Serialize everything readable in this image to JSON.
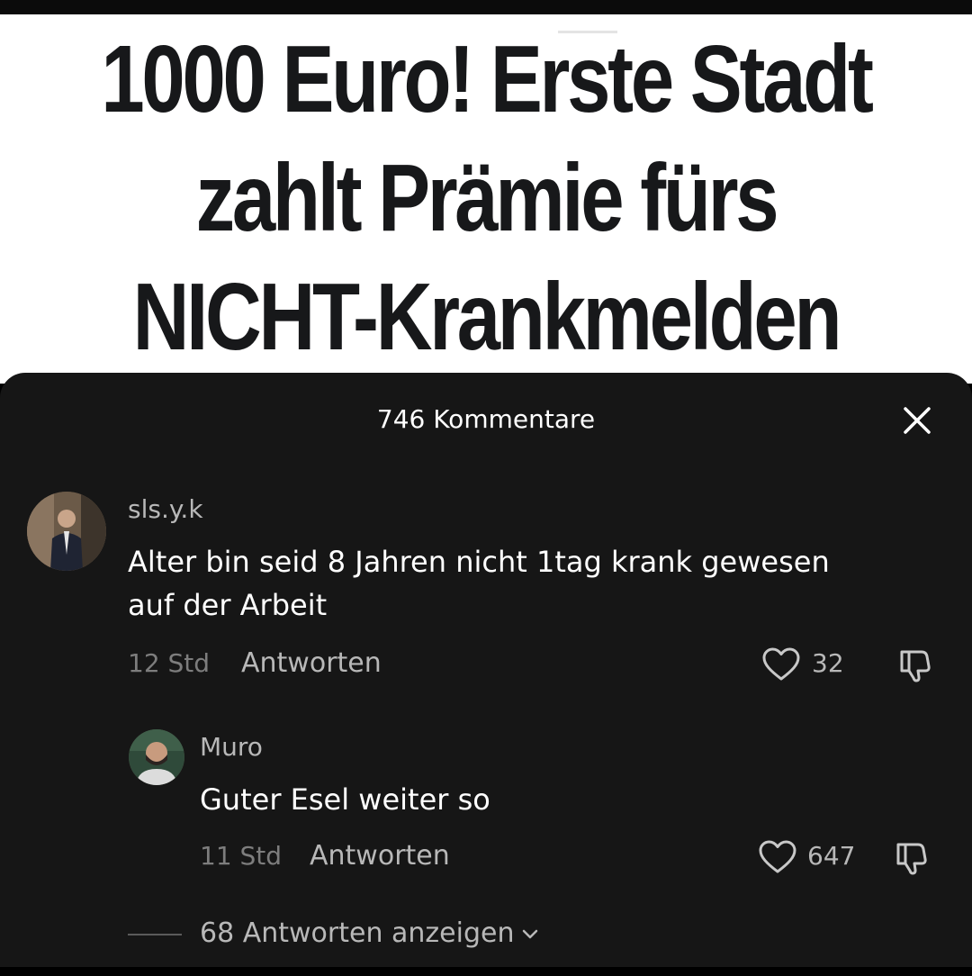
{
  "headline": {
    "line1": "1000 Euro! Erste Stadt",
    "line2": "zahlt Prämie fürs",
    "line3": "NICHT-Krankmelden"
  },
  "comments_sheet": {
    "title": "746 Kommentare",
    "close_icon": "close-icon"
  },
  "comments": [
    {
      "username": "sls.y.k",
      "text_line1": "Alter bin seid 8 Jahren nicht 1tag krank gewesen",
      "text_line2": "auf der Arbeit",
      "time": "12 Std",
      "reply_label": "Antworten",
      "likes": "32"
    }
  ],
  "replies": [
    {
      "username": "Muro",
      "text": "Guter Esel weiter so",
      "time": "11 Std",
      "reply_label": "Antworten",
      "likes": "647"
    }
  ],
  "show_more": {
    "label": "68 Antworten anzeigen"
  },
  "colors": {
    "sheet_bg": "#161616",
    "text_primary": "#ffffff",
    "text_secondary": "#b8b8b8",
    "text_muted": "#7d7d7d"
  }
}
